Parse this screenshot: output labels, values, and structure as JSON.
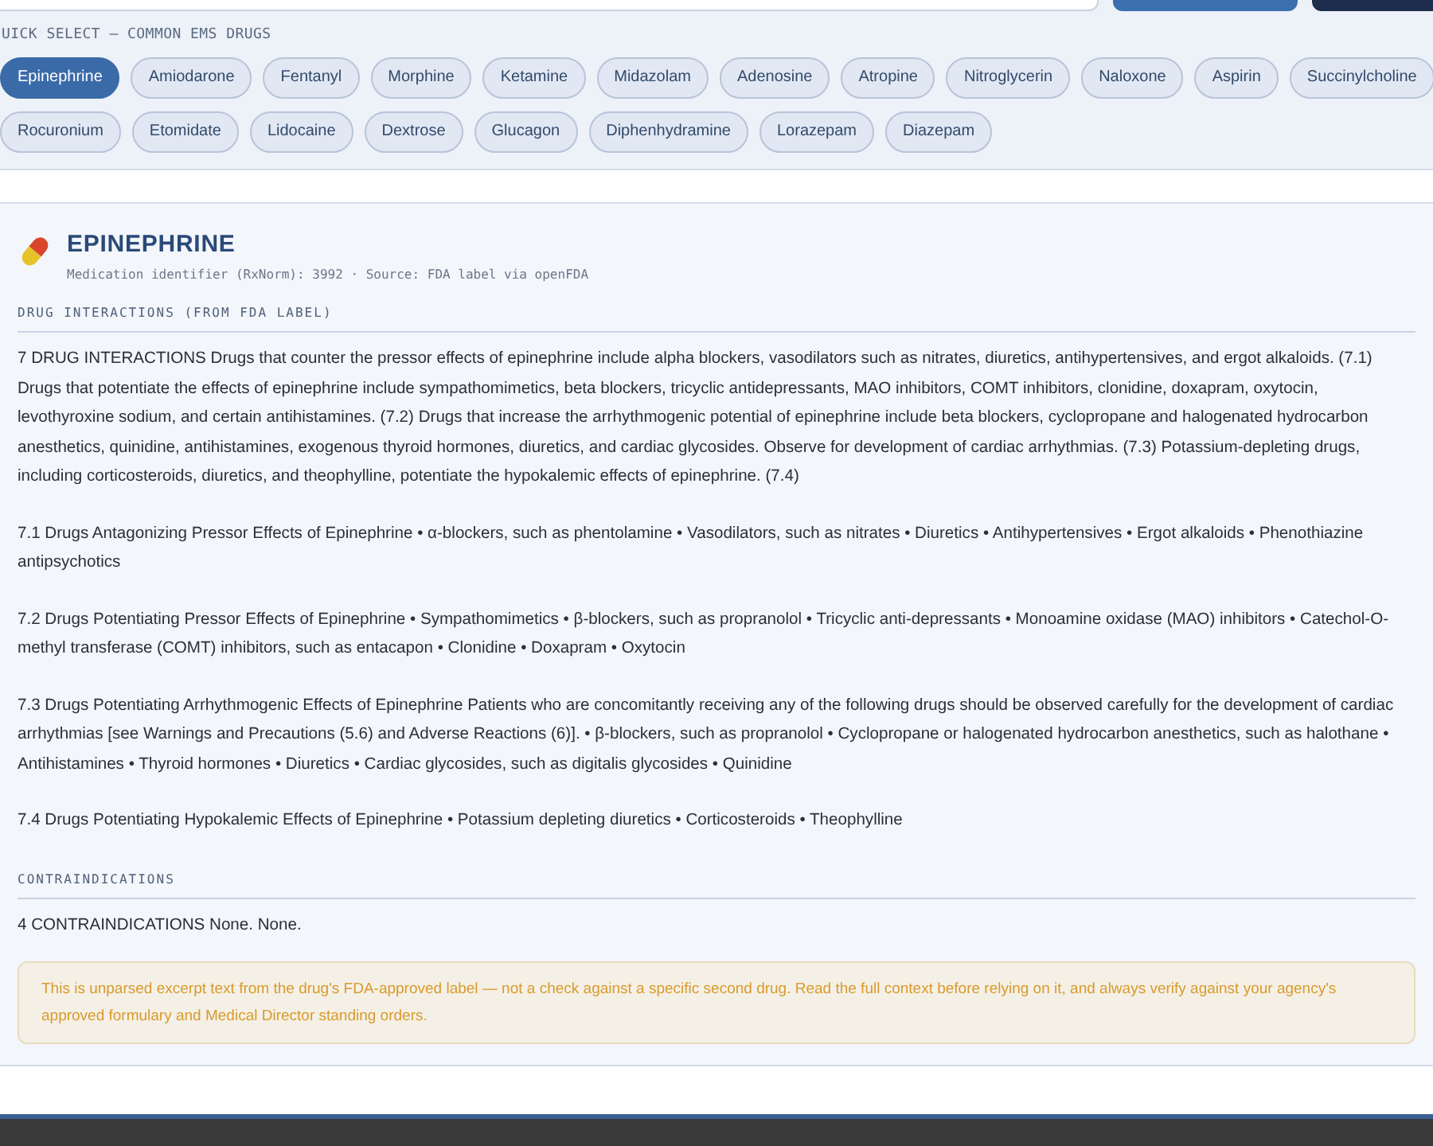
{
  "quick_select": {
    "label": "UICK SELECT — COMMON EMS DRUGS",
    "drugs": [
      {
        "name": "Epinephrine",
        "selected": true
      },
      {
        "name": "Amiodarone",
        "selected": false
      },
      {
        "name": "Fentanyl",
        "selected": false
      },
      {
        "name": "Morphine",
        "selected": false
      },
      {
        "name": "Ketamine",
        "selected": false
      },
      {
        "name": "Midazolam",
        "selected": false
      },
      {
        "name": "Adenosine",
        "selected": false
      },
      {
        "name": "Atropine",
        "selected": false
      },
      {
        "name": "Nitroglycerin",
        "selected": false
      },
      {
        "name": "Naloxone",
        "selected": false
      },
      {
        "name": "Aspirin",
        "selected": false
      },
      {
        "name": "Succinylcholine",
        "selected": false
      },
      {
        "name": "Rocuronium",
        "selected": false
      },
      {
        "name": "Etomidate",
        "selected": false
      },
      {
        "name": "Lidocaine",
        "selected": false
      },
      {
        "name": "Dextrose",
        "selected": false
      },
      {
        "name": "Glucagon",
        "selected": false
      },
      {
        "name": "Diphenhydramine",
        "selected": false
      },
      {
        "name": "Lorazepam",
        "selected": false
      },
      {
        "name": "Diazepam",
        "selected": false
      }
    ]
  },
  "drug": {
    "name": "EPINEPHRINE",
    "meta": "Medication identifier (RxNorm): 3992 · Source: FDA label via openFDA"
  },
  "sections": [
    {
      "heading": "DRUG INTERACTIONS (FROM FDA LABEL)",
      "paragraphs": [
        "7 DRUG INTERACTIONS Drugs that counter the pressor effects of epinephrine include alpha blockers, vasodilators such as nitrates, diuretics, antihypertensives, and ergot alkaloids. (7.1) Drugs that potentiate the effects of epinephrine include sympathomimetics, beta blockers, tricyclic antidepressants, MAO inhibitors, COMT inhibitors, clonidine, doxapram, oxytocin, levothyroxine sodium, and certain antihistamines. (7.2) Drugs that increase the arrhythmogenic potential of epinephrine include beta blockers, cyclopropane and halogenated hydrocarbon anesthetics, quinidine, antihistamines, exogenous thyroid hormones, diuretics, and cardiac glycosides. Observe for development of cardiac arrhythmias. (7.3) Potassium-depleting drugs, including corticosteroids, diuretics, and theophylline, potentiate the hypokalemic effects of epinephrine. (7.4)",
        "7.1 Drugs Antagonizing Pressor Effects of Epinephrine • α-blockers, such as phentolamine • Vasodilators, such as nitrates • Diuretics • Antihypertensives • Ergot alkaloids • Phenothiazine antipsychotics",
        "7.2 Drugs Potentiating Pressor Effects of Epinephrine • Sympathomimetics • β-blockers, such as propranolol • Tricyclic anti-depressants • Monoamine oxidase (MAO) inhibitors • Catechol-O-methyl transferase (COMT) inhibitors, such as entacapon • Clonidine • Doxapram • Oxytocin",
        "7.3 Drugs Potentiating Arrhythmogenic Effects of Epinephrine Patients who are concomitantly receiving any of the following drugs should be observed carefully for the development of cardiac arrhythmias [see Warnings and Precautions (5.6) and Adverse Reactions (6)]. • β-blockers, such as propranolol • Cyclopropane or halogenated hydrocarbon anesthetics, such as halothane • Antihistamines • Thyroid hormones • Diuretics • Cardiac glycosides, such as digitalis glycosides • Quinidine",
        "7.4 Drugs Potentiating Hypokalemic Effects of Epinephrine • Potassium depleting diuretics • Corticosteroids • Theophylline"
      ]
    },
    {
      "heading": "CONTRAINDICATIONS",
      "paragraphs": [
        "4 CONTRAINDICATIONS None. None."
      ]
    }
  ],
  "notice": "This is unparsed excerpt text from the drug's FDA-approved label — not a check against a specific second drug. Read the full context before relying on it, and always verify against your agency's approved formulary and Medical Director standing orders."
}
